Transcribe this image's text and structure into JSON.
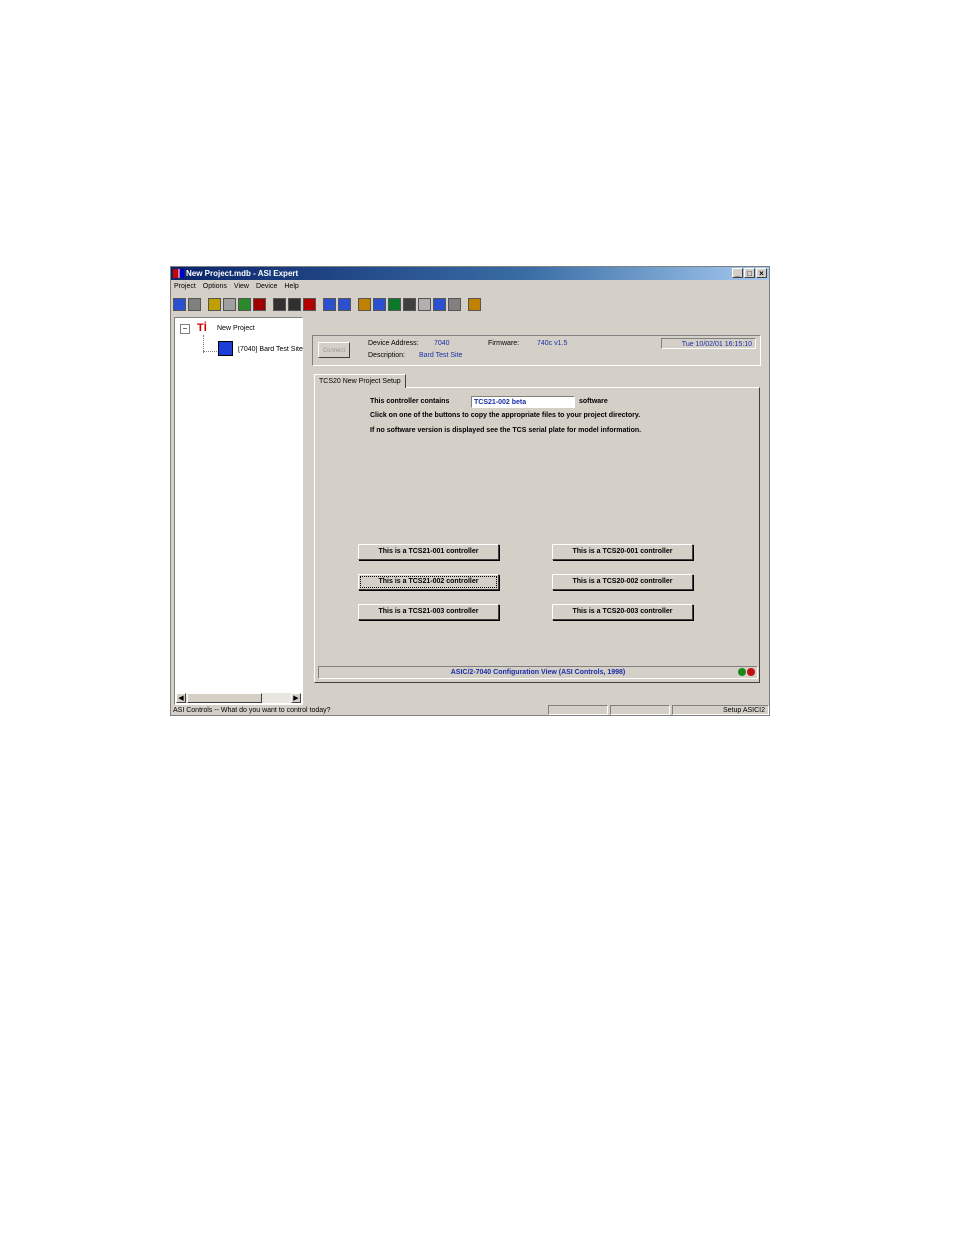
{
  "window": {
    "title": "New Project.mdb - ASI Expert",
    "controls": {
      "minimize": "_",
      "maximize": "□",
      "close": "×"
    }
  },
  "menu": [
    "Project",
    "Options",
    "View",
    "Device",
    "Help"
  ],
  "toolbar": {
    "buttons": [
      {
        "icon": "monitor-icon",
        "color": "#2a4fd0"
      },
      {
        "icon": "print-icon",
        "color": "#808080"
      },
      {
        "icon": "chart-icon",
        "color": "#c0a000"
      },
      {
        "icon": "grid-icon",
        "color": "#a0a0a0"
      },
      {
        "icon": "people-icon",
        "color": "#2a8a2a"
      },
      {
        "icon": "record-icon",
        "color": "#a00000"
      },
      {
        "icon": "save-icon",
        "color": "#303030"
      },
      {
        "icon": "save-as-icon",
        "color": "#303030"
      },
      {
        "icon": "save-red-icon",
        "color": "#b00000"
      },
      {
        "icon": "download-icon",
        "color": "#2a4fd0"
      },
      {
        "icon": "upload-icon",
        "color": "#2a4fd0"
      },
      {
        "icon": "house-icon",
        "color": "#c08000"
      },
      {
        "icon": "tools-icon",
        "color": "#2a4fd0"
      },
      {
        "icon": "device-icon",
        "color": "#0a7a2a"
      },
      {
        "icon": "panel-icon",
        "color": "#404040"
      },
      {
        "icon": "disabled-icon",
        "color": "#b0b0b0"
      },
      {
        "icon": "list-icon",
        "color": "#2a4fd0"
      },
      {
        "icon": "table-icon",
        "color": "#808080"
      },
      {
        "icon": "help-icon",
        "color": "#c08000"
      }
    ]
  },
  "tree": {
    "expander": "−",
    "root_icon": "Tİ",
    "root_label": "New Project",
    "child_label": "[7040] Bard Test Site"
  },
  "device": {
    "connect_label": "Connect",
    "address_label": "Device Address:",
    "address_value": "7040",
    "firmware_label": "Firmware:",
    "firmware_value": "740c v1.5",
    "description_label": "Description:",
    "description_value": "Bard Test Site",
    "datetime": "Tue 10/02/01  16:15:10"
  },
  "tab": {
    "label": "TCS20 New Project Setup"
  },
  "setup": {
    "contains_label": "This controller contains",
    "software_value": "TCS21-002 beta",
    "software_suffix": "software",
    "instruction_1": "Click on one of the buttons to copy the appropriate files to your project directory.",
    "instruction_2": "If no software version is displayed see the TCS serial plate for model information."
  },
  "controller_buttons": {
    "tcs21_001": "This is a TCS21-001 controller",
    "tcs21_002": "This is a TCS21-002 controller",
    "tcs21_003": "This is a TCS21-003 controller",
    "tcs20_001": "This is a TCS20-001 controller",
    "tcs20_002": "This is a TCS20-002 controller",
    "tcs20_003": "This is a TCS20-003 controller"
  },
  "footer": {
    "text": "ASIC/2-7040 Configuration View (ASI Controls, 1998)",
    "led_colors": [
      "#1a8a1a",
      "#c01010"
    ]
  },
  "statusbar": {
    "message": "ASI Controls -- What do you want to control today?",
    "setup": "Setup ASICI2"
  }
}
